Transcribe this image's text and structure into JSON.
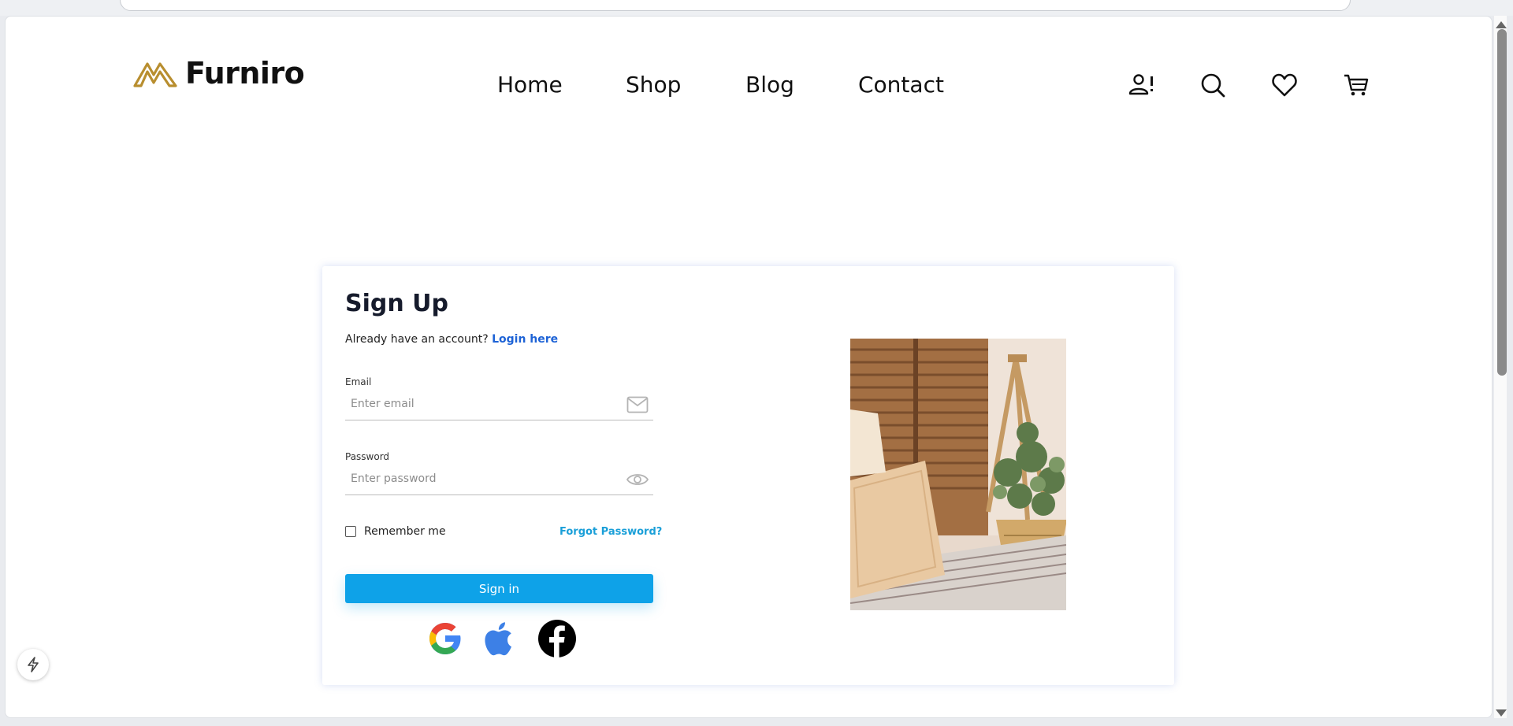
{
  "brand": {
    "name": "Furniro",
    "accent": "#b88e2f"
  },
  "nav": {
    "items": [
      "Home",
      "Shop",
      "Blog",
      "Contact"
    ]
  },
  "header_icons": [
    "user-alert-icon",
    "search-icon",
    "heart-icon",
    "cart-icon"
  ],
  "signup": {
    "title": "Sign Up",
    "already_text": "Already have an account?",
    "login_link": "Login here",
    "email_label": "Email",
    "email_placeholder": "Enter email",
    "password_label": "Password",
    "password_placeholder": "Enter password",
    "remember_label": "Remember me",
    "forgot_link": "Forgot Password?",
    "signin_button": "Sign in",
    "social": [
      "google-icon",
      "apple-icon",
      "facebook-icon"
    ]
  },
  "colors": {
    "primary_button": "#0ea2e8",
    "link_blue": "#1e63d6",
    "forgot_link": "#1a9fd8"
  }
}
